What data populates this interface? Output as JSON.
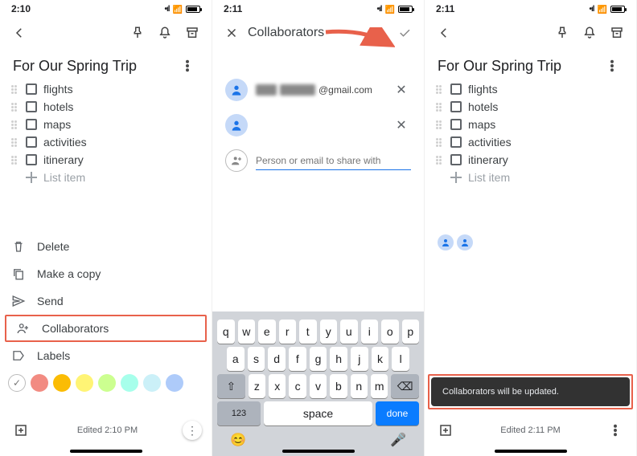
{
  "panel1": {
    "time": "2:10",
    "note_title": "For Our Spring Trip",
    "items": [
      "flights",
      "hotels",
      "maps",
      "activities",
      "itinerary"
    ],
    "new_item": "List item",
    "menu": {
      "delete": "Delete",
      "copy": "Make a copy",
      "send": "Send",
      "collab": "Collaborators",
      "labels": "Labels"
    },
    "colors": [
      "#ffffff",
      "#f28b82",
      "#fbbc04",
      "#fff475",
      "#ccff90",
      "#a7ffeb",
      "#cbf0f8",
      "#aecbfa"
    ],
    "edited": "Edited 2:10 PM"
  },
  "panel2": {
    "time": "2:11",
    "title": "Collaborators",
    "email_suffix": "@gmail.com",
    "placeholder": "Person or email to share with",
    "keys_row1": [
      "q",
      "w",
      "e",
      "r",
      "t",
      "y",
      "u",
      "i",
      "o",
      "p"
    ],
    "keys_row2": [
      "a",
      "s",
      "d",
      "f",
      "g",
      "h",
      "j",
      "k",
      "l"
    ],
    "keys_row3": [
      "z",
      "x",
      "c",
      "v",
      "b",
      "n",
      "m"
    ],
    "key_123": "123",
    "key_space": "space",
    "key_done": "done"
  },
  "panel3": {
    "time": "2:11",
    "note_title": "For Our Spring Trip",
    "items": [
      "flights",
      "hotels",
      "maps",
      "activities",
      "itinerary"
    ],
    "new_item": "List item",
    "toast": "Collaborators will be updated.",
    "edited": "Edited 2:11 PM"
  }
}
